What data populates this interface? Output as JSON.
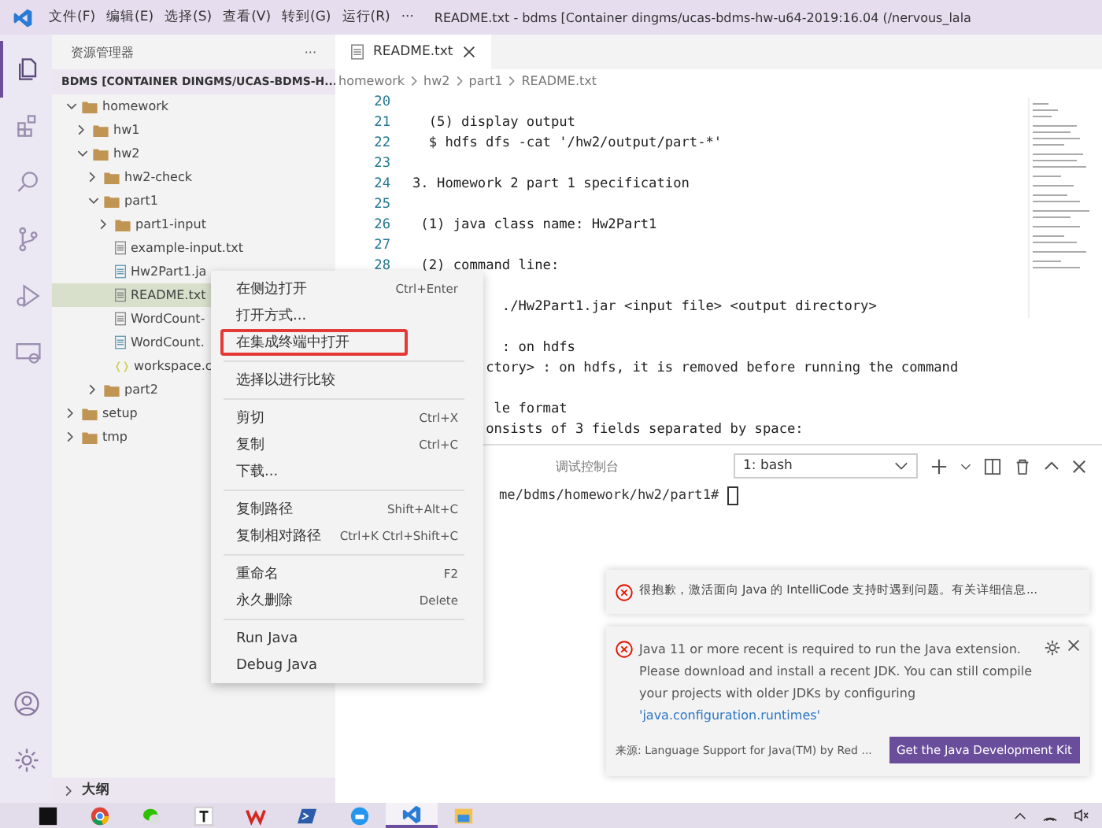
{
  "title_bar": {
    "menus": [
      "文件(F)",
      "编辑(E)",
      "选择(S)",
      "查看(V)",
      "转到(G)",
      "运行(R)",
      "···"
    ],
    "title": "README.txt - bdms [Container dingms/ucas-bdms-hw-u64-2019:16.04 (/nervous_lala"
  },
  "activity_bar": [
    {
      "kind": "files",
      "selected": true
    },
    {
      "kind": "extensions",
      "selected": false
    },
    {
      "kind": "search",
      "selected": false
    },
    {
      "kind": "git",
      "selected": false
    },
    {
      "kind": "run",
      "selected": false
    },
    {
      "kind": "remote",
      "selected": false
    }
  ],
  "sidebar": {
    "title": "资源管理器",
    "more": "···",
    "root": "BDMS [CONTAINER DINGMS/UCAS-BDMS-H...",
    "tree": [
      {
        "name": "homework",
        "kind": "folder",
        "expanded": true,
        "selected": false,
        "children": [
          {
            "name": "hw1",
            "kind": "folder",
            "expanded": false,
            "selected": false
          },
          {
            "name": "hw2",
            "kind": "folder",
            "expanded": true,
            "selected": false,
            "children": [
              {
                "name": "hw2-check",
                "kind": "folder",
                "expanded": false,
                "selected": false
              },
              {
                "name": "part1",
                "kind": "folder",
                "expanded": true,
                "selected": false,
                "children": [
                  {
                    "name": "part1-input",
                    "kind": "folder",
                    "expanded": false,
                    "selected": false
                  },
                  {
                    "name": "example-input.txt",
                    "kind": "text",
                    "selected": false
                  },
                  {
                    "name": "Hw2Part1.ja",
                    "kind": "java",
                    "selected": false
                  },
                  {
                    "name": "README.txt",
                    "kind": "text",
                    "selected": true
                  },
                  {
                    "name": "WordCount-",
                    "kind": "text",
                    "selected": false
                  },
                  {
                    "name": "WordCount.",
                    "kind": "java",
                    "selected": false
                  },
                  {
                    "name": "workspace.c",
                    "kind": "json",
                    "selected": false
                  }
                ]
              },
              {
                "name": "part2",
                "kind": "folder",
                "expanded": false,
                "selected": false
              }
            ]
          }
        ]
      },
      {
        "name": "setup",
        "kind": "folder",
        "expanded": false,
        "selected": false
      },
      {
        "name": "tmp",
        "kind": "folder",
        "expanded": false,
        "selected": false
      }
    ],
    "outline": "大纲"
  },
  "editor": {
    "tab": "README.txt",
    "breadcrumb": [
      "homework",
      "hw2",
      "part1",
      "README.txt"
    ],
    "lines": [
      {
        "number": "20"
      },
      {
        "number": "21",
        "text": "  (5) display output"
      },
      {
        "number": "22",
        "text": "  $ hdfs dfs -cat '/hw2/output/part-*'"
      },
      {
        "number": "23"
      },
      {
        "number": "24",
        "text": "3. Homework 2 part 1 specification"
      },
      {
        "number": "25"
      },
      {
        "number": "26",
        "text": " (1) java class name: Hw2Part1"
      },
      {
        "number": "27"
      },
      {
        "number": "28",
        "text": " (2) command line:"
      }
    ],
    "covered_blocks": [
      [
        "           ./Hw2Part1.jar <input file> <output directory>"
      ],
      [
        "           : on hdfs",
        "         ctory> : on hdfs, it is removed before running the command"
      ],
      [
        "          le format",
        "         onsists of 3 fields separated by space:"
      ]
    ]
  },
  "panel": {
    "tab": "调试控制台",
    "terminal_select": "1: bash",
    "prompt": "me/bdms/homework/hw2/part1# "
  },
  "context_menu": [
    [
      {
        "label": "在侧边打开",
        "shortcut": "Ctrl+Enter",
        "outlined": false
      },
      {
        "label": "打开方式...",
        "outlined": false
      },
      {
        "label": "在集成终端中打开",
        "outlined": true
      }
    ],
    [
      {
        "label": "选择以进行比较",
        "outlined": false
      }
    ],
    [
      {
        "label": "剪切",
        "shortcut": "Ctrl+X",
        "outlined": false
      },
      {
        "label": "复制",
        "shortcut": "Ctrl+C",
        "outlined": false
      },
      {
        "label": "下载...",
        "outlined": false
      }
    ],
    [
      {
        "label": "复制路径",
        "shortcut": "Shift+Alt+C",
        "outlined": false
      },
      {
        "label": "复制相对路径",
        "shortcut": "Ctrl+K Ctrl+Shift+C",
        "outlined": false
      }
    ],
    [
      {
        "label": "重命名",
        "shortcut": "F2",
        "outlined": false
      },
      {
        "label": "永久删除",
        "shortcut": "Delete",
        "outlined": false
      }
    ],
    [
      {
        "label": "Run Java",
        "outlined": false
      },
      {
        "label": "Debug Java",
        "outlined": false
      }
    ]
  ],
  "notifications": [
    {
      "text": "很抱歉，激活面向 Java 的 IntelliCode 支持时遇到问题。有关详细信息..."
    },
    {
      "text": "Java 11 or more recent is required to run the Java extension. Please download and install a recent JDK. You can still compile your projects with older JDKs by configuring",
      "link": "'java.configuration.runtimes'",
      "source": "来源: Language Support for Java(TM) by Red ...",
      "button": "Get the Java Development Kit"
    }
  ],
  "taskbar": [
    {
      "kind": "pycharm",
      "selected": false
    },
    {
      "kind": "chrome",
      "selected": false
    },
    {
      "kind": "wechat",
      "selected": false
    },
    {
      "kind": "typora",
      "selected": false
    },
    {
      "kind": "wps",
      "selected": false
    },
    {
      "kind": "powershell",
      "selected": false
    },
    {
      "kind": "docker",
      "selected": false
    },
    {
      "kind": "vscode",
      "selected": true
    },
    {
      "kind": "explorer",
      "selected": false
    }
  ]
}
